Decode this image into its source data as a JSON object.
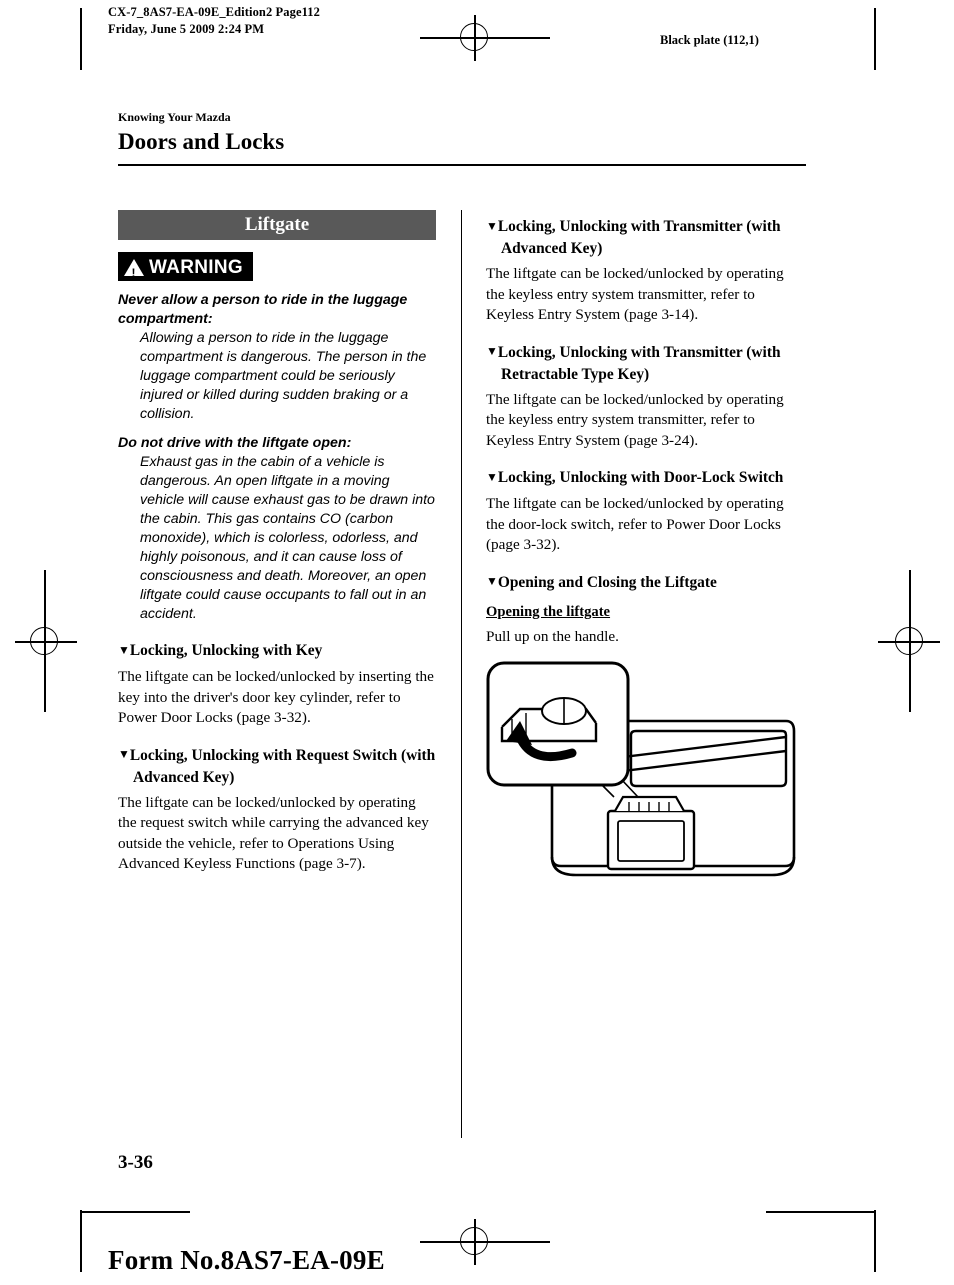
{
  "header": {
    "left_line1": "CX-7_8AS7-EA-09E_Edition2 Page112",
    "left_line2": "Friday, June 5 2009 2:24 PM",
    "right": "Black plate (112,1)"
  },
  "page": {
    "breadcrumb": "Knowing Your Mazda",
    "chapter_title": "Doors and Locks",
    "page_number": "3-36",
    "form_number": "Form No.8AS7-EA-09E"
  },
  "left_column": {
    "section_banner": "Liftgate",
    "warning_label": "WARNING",
    "warnings": [
      {
        "head": "Never allow a person to ride in the luggage compartment:",
        "body": "Allowing a person to ride in the luggage compartment is dangerous. The person in the luggage compartment could be seriously injured or killed during sudden braking or a collision."
      },
      {
        "head": "Do not drive with the liftgate open:",
        "body": "Exhaust gas in the cabin of a vehicle is dangerous. An open liftgate in a moving vehicle will cause exhaust gas to be drawn into the cabin. This gas contains CO (carbon monoxide), which is colorless, odorless, and highly poisonous, and it can cause loss of consciousness and death. Moreover, an open liftgate could cause occupants to fall out in an accident."
      }
    ],
    "topics": [
      {
        "heading": "Locking, Unlocking with Key",
        "body": "The liftgate can be locked/unlocked by inserting the key into the driver's door key cylinder, refer to Power Door Locks (page 3-32)."
      },
      {
        "heading": "Locking, Unlocking with Request Switch (with Advanced Key)",
        "body": "The liftgate can be locked/unlocked by operating the request switch while carrying the advanced key outside the vehicle, refer to Operations Using Advanced Keyless Functions (page 3-7)."
      }
    ]
  },
  "right_column": {
    "topics": [
      {
        "heading": "Locking, Unlocking with Transmitter (with Advanced Key)",
        "body": "The liftgate can be locked/unlocked by operating the keyless entry system transmitter, refer to Keyless Entry System (page 3-14)."
      },
      {
        "heading": "Locking, Unlocking with Transmitter (with Retractable Type Key)",
        "body": "The liftgate can be locked/unlocked by operating the keyless entry system transmitter, refer to Keyless Entry System (page 3-24)."
      },
      {
        "heading": "Locking, Unlocking with Door-Lock Switch",
        "body": "The liftgate can be locked/unlocked by operating the door-lock switch, refer to Power Door Locks (page 3-32)."
      },
      {
        "heading": "Opening and Closing the Liftgate",
        "sub_heading": "Opening the liftgate",
        "body": "Pull up on the handle."
      }
    ],
    "figure_caption": ""
  },
  "icons": {
    "bullet": "▼",
    "warning_triangle": "warning-triangle-icon"
  },
  "colors": {
    "banner_bg": "#595959",
    "warning_bg": "#000000",
    "text": "#000000",
    "page_bg": "#ffffff"
  }
}
